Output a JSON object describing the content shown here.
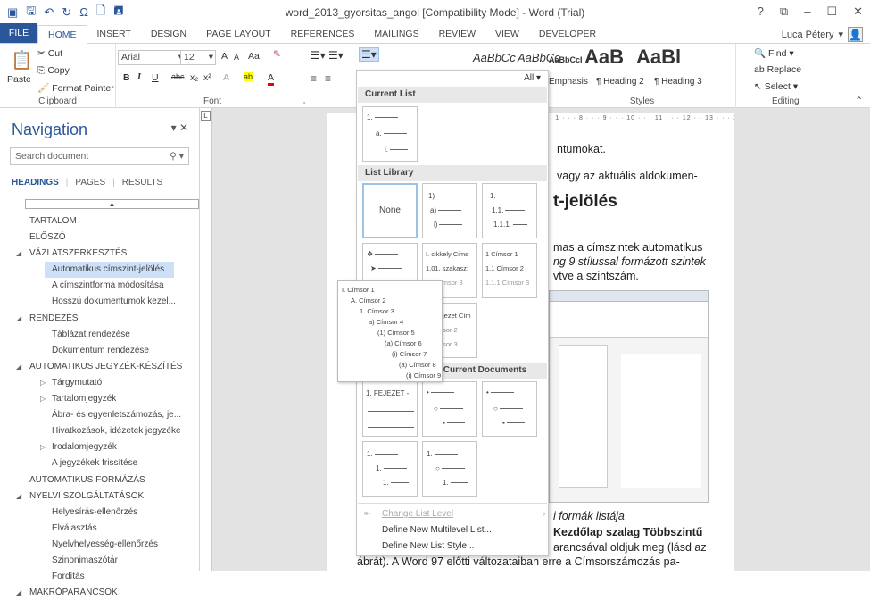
{
  "title": "word_2013_gyorsitas_angol [Compatibility Mode] - Word (Trial)",
  "window_controls": [
    "?",
    "⧉",
    "–",
    "☐",
    "✕"
  ],
  "tabs": [
    "FILE",
    "HOME",
    "INSERT",
    "DESIGN",
    "PAGE LAYOUT",
    "REFERENCES",
    "MAILINGS",
    "REVIEW",
    "VIEW",
    "DEVELOPER"
  ],
  "user": "Luca Pétery",
  "clipboard": {
    "paste": "Paste",
    "cut": "Cut",
    "copy": "Copy",
    "format_painter": "Format Painter",
    "label": "Clipboard"
  },
  "font": {
    "name": "Arial",
    "size": "12",
    "label": "Font",
    "case": "Aa",
    "bold": "B",
    "italic": "I",
    "underline": "U",
    "strike": "abc",
    "sub": "x₂",
    "sup": "x²",
    "grow": "A",
    "shrink": "A",
    "clear": "A",
    "highlight": "ab",
    "color": "A"
  },
  "styles": {
    "label": "Styles",
    "items": [
      "AaBbCc",
      "AaBbCc",
      "AaBbCcI",
      "AaB",
      "AaBl"
    ],
    "names": [
      "ction",
      "Emphasis",
      "¶ Heading 2",
      "¶ Heading 3"
    ],
    "all": "All"
  },
  "editing": {
    "find": "Find",
    "replace": "Replace",
    "select": "Select",
    "label": "Editing"
  },
  "navigation": {
    "title": "Navigation",
    "search_placeholder": "Search document",
    "tabs": [
      "HEADINGS",
      "PAGES",
      "RESULTS"
    ],
    "items": [
      {
        "text": "TARTALOM",
        "indent": 0,
        "tri": ""
      },
      {
        "text": "ELŐSZÓ",
        "indent": 0,
        "tri": ""
      },
      {
        "text": "VÁZLATSZERKESZTÉS",
        "indent": 0,
        "tri": "◢"
      },
      {
        "text": "Automatikus címszint-jelölés",
        "indent": 2,
        "tri": "",
        "sel": true
      },
      {
        "text": "A címszintforma módosítása",
        "indent": 2,
        "tri": ""
      },
      {
        "text": "Hosszú dokumentumok kezel...",
        "indent": 2,
        "tri": ""
      },
      {
        "text": "RENDEZÉS",
        "indent": 0,
        "tri": "◢"
      },
      {
        "text": "Táblázat rendezése",
        "indent": 2,
        "tri": ""
      },
      {
        "text": "Dokumentum rendezése",
        "indent": 2,
        "tri": ""
      },
      {
        "text": "AUTOMATIKUS JEGYZÉK-KÉSZÍTÉS",
        "indent": 0,
        "tri": "◢"
      },
      {
        "text": "Tárgymutató",
        "indent": 1,
        "tri": "▷"
      },
      {
        "text": "Tartalomjegyzék",
        "indent": 1,
        "tri": "▷"
      },
      {
        "text": "Ábra- és egyenletszámozás, je...",
        "indent": 2,
        "tri": ""
      },
      {
        "text": "Hivatkozások, idézetek jegyzéke",
        "indent": 2,
        "tri": ""
      },
      {
        "text": "Irodalomjegyzék",
        "indent": 1,
        "tri": "▷"
      },
      {
        "text": "A jegyzékek frissítése",
        "indent": 2,
        "tri": ""
      },
      {
        "text": "AUTOMATIKUS FORMÁZÁS",
        "indent": 0,
        "tri": ""
      },
      {
        "text": "NYELVI SZOLGÁLTATÁSOK",
        "indent": 0,
        "tri": "◢"
      },
      {
        "text": "Helyesírás-ellenőrzés",
        "indent": 2,
        "tri": ""
      },
      {
        "text": "Elválasztás",
        "indent": 2,
        "tri": ""
      },
      {
        "text": "Nyelvhelyesség-ellenőrzés",
        "indent": 2,
        "tri": ""
      },
      {
        "text": "Szinonimaszótár",
        "indent": 2,
        "tri": ""
      },
      {
        "text": "Fordítás",
        "indent": 2,
        "tri": ""
      },
      {
        "text": "MAKRÓPARANCSOK",
        "indent": 0,
        "tri": "◢"
      }
    ]
  },
  "ruler": "· 1 · · · 8 · · · 9 · · · 10 · · · 11 · · · 12 · · 13 · · · 14",
  "document": {
    "lines": [
      "ntumokat.",
      "vagy az aktuális aldokumen-",
      "t-jelölés",
      "mas a címszintek automatikus",
      "ng 9 stílussal formázott szintek",
      "vtve a szintszám.",
      "i formák listája",
      "Kezdőlap szalag Többszintű",
      "arancsával oldjuk meg (lásd az",
      "ábrát). A Word 97 előtti változataiban erre a Címsorszámozás pa-"
    ]
  },
  "list_dropdown": {
    "all": "All ▾",
    "sections": [
      "Current List",
      "List Library",
      "Lists in Current Documents"
    ],
    "none_label": "None",
    "menu": [
      "Change List Level",
      "Define New Multilevel List...",
      "Define New List Style..."
    ],
    "tiles_lib": [
      [
        "1)",
        "a)",
        "i)"
      ],
      [
        "1.",
        "1.1.",
        "1.1.1."
      ],
      [
        "❖",
        "➤",
        "■"
      ],
      [
        "I. cikkely Cims",
        "1.01. szakasz:",
        "(a) Címsor 3"
      ],
      [
        "1 Címsor 1",
        "1.1 Címsor 2",
        "1.1.1 Címsor 3"
      ]
    ],
    "chapter_tile": [
      "jezet Cím",
      "sor 2",
      "sor 3"
    ],
    "doc_tiles": [
      [
        "1. FEJEZET -",
        "",
        ""
      ],
      [
        "•",
        "○",
        "▪"
      ],
      [
        "•",
        "○",
        "▪"
      ],
      [
        "1.",
        "1.",
        "1."
      ],
      [
        "1.",
        "○",
        "1."
      ]
    ]
  },
  "flyout": [
    "I. Címsor 1",
    "A. Címsor 2",
    "1. Címsor 3",
    "a) Címsor 4",
    "(1) Címsor 5",
    "(a) Címsor 6",
    "(i) Címsor 7",
    "(a) Címsor 8",
    "(i) Címsor 9"
  ]
}
